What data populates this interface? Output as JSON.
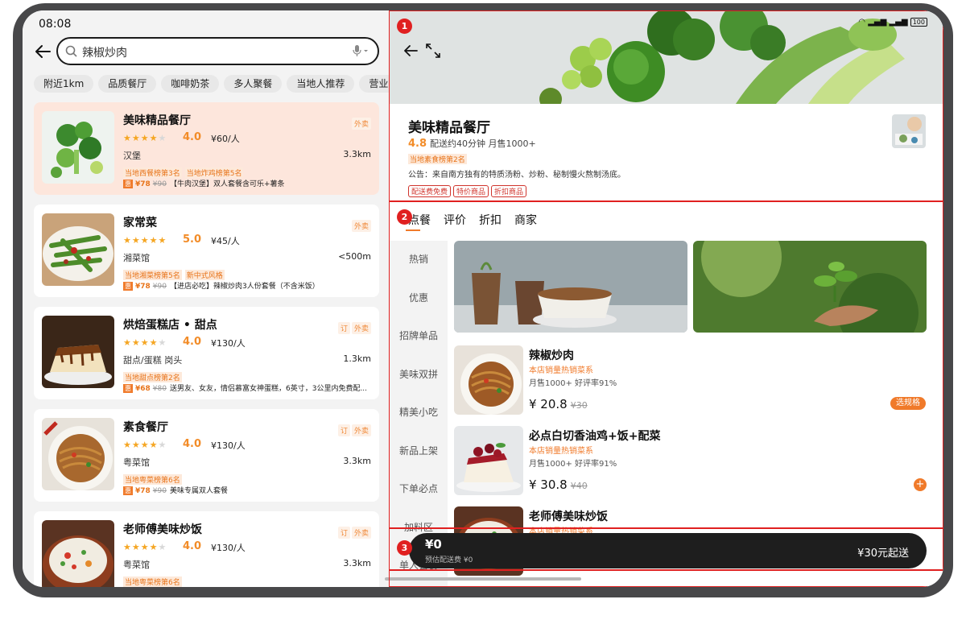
{
  "status": {
    "time": "08:08",
    "battery": "100"
  },
  "search": {
    "value": "辣椒炒肉"
  },
  "chips": [
    "附近1km",
    "品质餐厅",
    "咖啡奶茶",
    "多人聚餐",
    "当地人推荐",
    "营业"
  ],
  "restaurants": [
    {
      "name": "美味精品餐厅",
      "tags": [
        "外卖"
      ],
      "stars": 4,
      "score": "4.0",
      "price": "¥60/人",
      "category": "汉堡",
      "distance": "3.3km",
      "ranks": [
        "当地西餐榜第3名",
        "当地炸鸡榜第5名"
      ],
      "deal_badge": "惠",
      "deal_price": "¥78",
      "deal_orig": "¥90",
      "deal_text": "【牛肉汉堡】双人套餐含可乐+薯条"
    },
    {
      "name": "家常菜",
      "tags": [
        "外卖"
      ],
      "stars": 5,
      "score": "5.0",
      "price": "¥45/人",
      "category": "湘菜馆",
      "distance": "<500m",
      "ranks": [
        "当地湘菜榜第5名",
        "新中式风格"
      ],
      "deal_badge": "惠",
      "deal_price": "¥78",
      "deal_orig": "¥90",
      "deal_text": "【进店必吃】辣椒炒肉3人份套餐（不含米饭）"
    },
    {
      "name": "烘焙蛋糕店 • 甜点",
      "tags": [
        "订",
        "外卖"
      ],
      "stars": 4,
      "score": "4.0",
      "price": "¥130/人",
      "category": "甜点/蛋糕 岗头",
      "distance": "1.3km",
      "ranks": [
        "当地甜点榜第2名"
      ],
      "deal_badge": "惠",
      "deal_price": "¥68",
      "deal_orig": "¥80",
      "deal_text": "送男友、女友，情侣慕富女神蛋糕，6英寸，3公里内免费配..."
    },
    {
      "name": "素食餐厅",
      "tags": [
        "订",
        "外卖"
      ],
      "stars": 4,
      "score": "4.0",
      "price": "¥130/人",
      "category": "粤菜馆",
      "distance": "3.3km",
      "ranks": [
        "当地粤菜榜第6名"
      ],
      "deal_badge": "惠",
      "deal_price": "¥78",
      "deal_orig": "¥90",
      "deal_text": "美味专属双人套餐"
    },
    {
      "name": "老师傅美味炒饭",
      "tags": [
        "订",
        "外卖"
      ],
      "stars": 4,
      "score": "4.0",
      "price": "¥130/人",
      "category": "粤菜馆",
      "distance": "3.3km",
      "ranks": [
        "当地粤菜榜第6名"
      ],
      "deal_badge": "",
      "deal_price": "",
      "deal_orig": "",
      "deal_text": ""
    }
  ],
  "shop": {
    "name": "美味精品餐厅",
    "score": "4.8",
    "meta": "配送约40分钟 月售1000+",
    "rank": "当地素食榜第2名",
    "notice": "公告：来自南方独有的特质汤粉、炒粉、秘制慢火熬制汤底。",
    "badges": [
      "配送费免费",
      "特价商品",
      "折扣商品"
    ]
  },
  "tabs": [
    "点餐",
    "评价",
    "折扣",
    "商家"
  ],
  "categories": [
    "热销",
    "优惠",
    "招牌单品",
    "美味双拼",
    "精美小吃",
    "新品上架",
    "下单必点",
    "加料区",
    "单人套餐"
  ],
  "dishes": [
    {
      "name": "辣椒炒肉",
      "rank": "本店销量热销菜系",
      "stats": "月售1000+   好评率91%",
      "price": "¥ 20.8",
      "orig": "¥30",
      "action": "选规格"
    },
    {
      "name": "必点白切香油鸡+饭+配菜",
      "rank": "本店销量热销菜系",
      "stats": "月售1000+   好评率91%",
      "price": "¥ 30.8",
      "orig": "¥40",
      "action": "+"
    },
    {
      "name": "老师傅美味炒饭",
      "rank": "本店销量热销菜系",
      "stats": "",
      "price": "",
      "orig": "",
      "action": ""
    }
  ],
  "cart": {
    "amount": "¥0",
    "fee": "预估配送费 ¥0",
    "min_order": "¥30元起送"
  },
  "annotations": [
    "1",
    "2",
    "3"
  ],
  "colors": {
    "accent": "#f07a2a",
    "score": "#f28c28",
    "annotation": "#e02020",
    "highlight_card": "#fde6dc"
  }
}
